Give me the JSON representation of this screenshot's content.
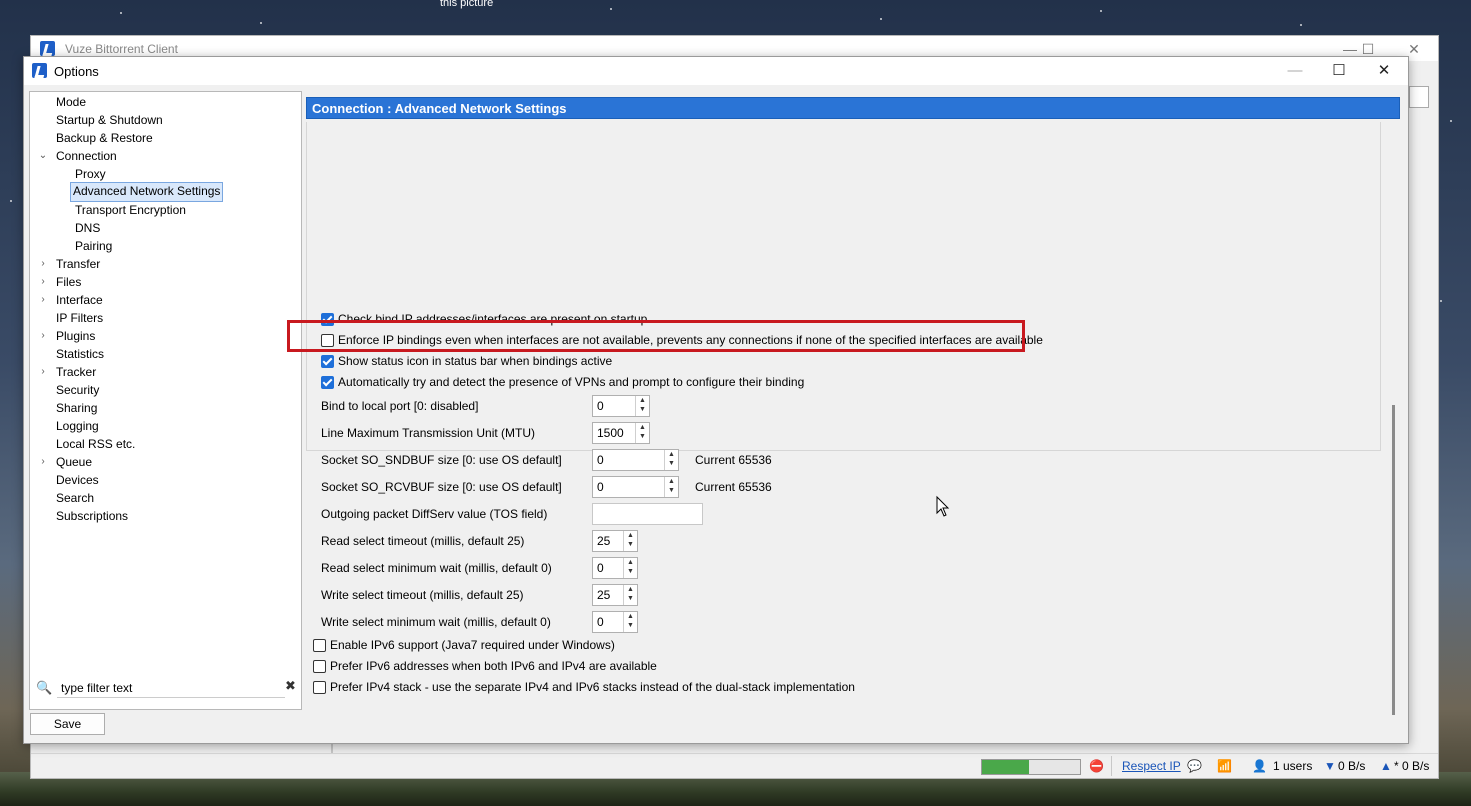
{
  "desktop": {
    "caption": "this picture"
  },
  "main_window": {
    "title": "Vuze Bittorrent Client",
    "status": {
      "progress_fraction": 0.48,
      "respect_ip": "Respect IP",
      "users": "1 users",
      "down": "0 B/s",
      "up": "* 0 B/s"
    }
  },
  "dialog": {
    "title": "Options",
    "tree": [
      {
        "label": "Mode",
        "level": 0,
        "expander": ""
      },
      {
        "label": "Startup & Shutdown",
        "level": 0,
        "expander": ""
      },
      {
        "label": "Backup & Restore",
        "level": 0,
        "expander": ""
      },
      {
        "label": "Connection",
        "level": 0,
        "expander": "open"
      },
      {
        "label": "Proxy",
        "level": 1,
        "expander": ""
      },
      {
        "label": "Advanced Network Settings",
        "level": 1,
        "expander": "",
        "selected": true
      },
      {
        "label": "Transport Encryption",
        "level": 1,
        "expander": ""
      },
      {
        "label": "DNS",
        "level": 1,
        "expander": ""
      },
      {
        "label": "Pairing",
        "level": 1,
        "expander": ""
      },
      {
        "label": "Transfer",
        "level": 0,
        "expander": "closed"
      },
      {
        "label": "Files",
        "level": 0,
        "expander": "closed"
      },
      {
        "label": "Interface",
        "level": 0,
        "expander": "closed"
      },
      {
        "label": "IP Filters",
        "level": 0,
        "expander": ""
      },
      {
        "label": "Plugins",
        "level": 0,
        "expander": "closed"
      },
      {
        "label": "Statistics",
        "level": 0,
        "expander": ""
      },
      {
        "label": "Tracker",
        "level": 0,
        "expander": "closed"
      },
      {
        "label": "Security",
        "level": 0,
        "expander": ""
      },
      {
        "label": "Sharing",
        "level": 0,
        "expander": ""
      },
      {
        "label": "Logging",
        "level": 0,
        "expander": ""
      },
      {
        "label": "Local RSS etc.",
        "level": 0,
        "expander": ""
      },
      {
        "label": "Queue",
        "level": 0,
        "expander": "closed"
      },
      {
        "label": "Devices",
        "level": 0,
        "expander": ""
      },
      {
        "label": "Search",
        "level": 0,
        "expander": ""
      },
      {
        "label": "Subscriptions",
        "level": 0,
        "expander": ""
      }
    ],
    "filter": {
      "value": "type filter text"
    },
    "save_label": "Save",
    "panel": {
      "header": "Connection : Advanced Network Settings",
      "checkboxes_top": [
        {
          "label": "Check bind IP addresses/interfaces are present on startup",
          "checked": true
        },
        {
          "label": "Enforce IP bindings even when interfaces are not available, prevents any connections if none of the specified interfaces are available",
          "checked": false
        },
        {
          "label": "Show status icon in status bar when bindings active",
          "checked": true
        },
        {
          "label": "Automatically try and detect the presence of VPNs and prompt to configure their binding",
          "checked": true
        }
      ],
      "fields": [
        {
          "label": "Bind to local port [0: disabled]",
          "value": "0",
          "type": "spin",
          "current": ""
        },
        {
          "label": "Line Maximum Transmission Unit (MTU)",
          "value": "1500",
          "type": "spin",
          "current": ""
        },
        {
          "label": "Socket SO_SNDBUF size [0: use OS default]",
          "value": "0",
          "type": "spin-wide",
          "current": "Current 65536"
        },
        {
          "label": "Socket SO_RCVBUF size [0: use OS default]",
          "value": "0",
          "type": "spin-wide",
          "current": "Current 65536"
        },
        {
          "label": "Outgoing packet DiffServ value (TOS field)",
          "value": "",
          "type": "text",
          "current": ""
        },
        {
          "label": "Read select timeout (millis, default 25)",
          "value": "25",
          "type": "spin-small",
          "current": ""
        },
        {
          "label": "Read select minimum wait (millis, default 0)",
          "value": "0",
          "type": "spin-small",
          "current": ""
        },
        {
          "label": "Write select timeout (millis, default 25)",
          "value": "25",
          "type": "spin-small",
          "current": ""
        },
        {
          "label": "Write select minimum wait (millis, default 0)",
          "value": "0",
          "type": "spin-small",
          "current": ""
        }
      ],
      "checkboxes_bottom": [
        {
          "label": "Enable IPv6 support (Java7 required under Windows)",
          "checked": false
        },
        {
          "label": "Prefer IPv6 addresses when both IPv6 and IPv4 are available",
          "checked": false
        },
        {
          "label": "Prefer IPv4 stack - use the separate IPv4 and IPv6 stacks instead of the dual-stack implementation",
          "checked": false
        }
      ]
    }
  },
  "colors": {
    "accent": "#2a74d6",
    "highlight": "#c8191f",
    "checkbox": "#1e6fd9"
  }
}
